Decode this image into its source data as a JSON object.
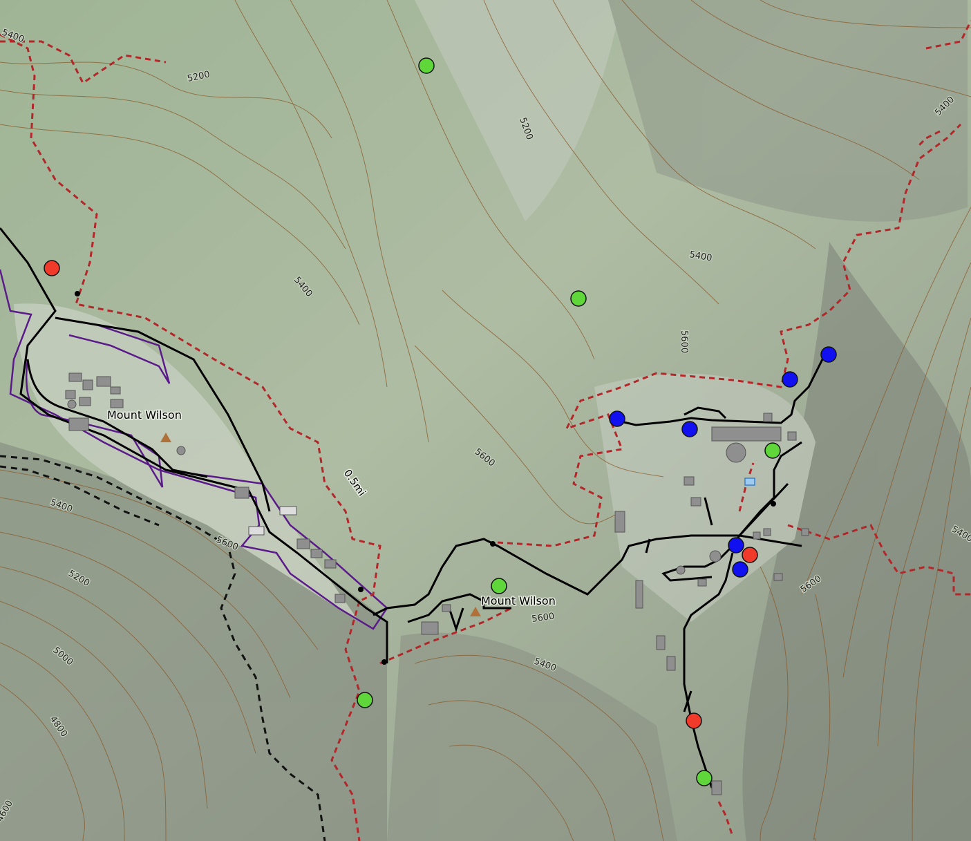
{
  "map": {
    "labels": {
      "peak_west": "Mount Wilson",
      "peak_east": "Mount Wilson",
      "scale": "0.5mi"
    },
    "contour_labels": {
      "c_nw_5400": "5400",
      "c_n_5200": "5200",
      "c_mid_5400": "5400",
      "c_top_5200": "5200",
      "c_ne_5400": "5400",
      "c_e_5400": "5400",
      "c_e_5600": "5600",
      "c_mid_5600": "5600",
      "c_w_5400": "5400",
      "c_w_5600": "5600",
      "c_w_5200": "5200",
      "c_w_5000": "5000",
      "c_sw_4800": "4800",
      "c_sw_4600": "4600",
      "c_s_5600": "5600",
      "c_s_5400": "5400",
      "c_se_5600": "5600",
      "c_far_e_5400": "5400"
    },
    "colors": {
      "green_marker": "#5fd63a",
      "red_marker": "#f03a2a",
      "blue_marker": "#1010f0",
      "trail": "#b3262a",
      "road": "#000000",
      "boundary": "#5a1a8a",
      "contour": "#8a5a2a"
    }
  }
}
